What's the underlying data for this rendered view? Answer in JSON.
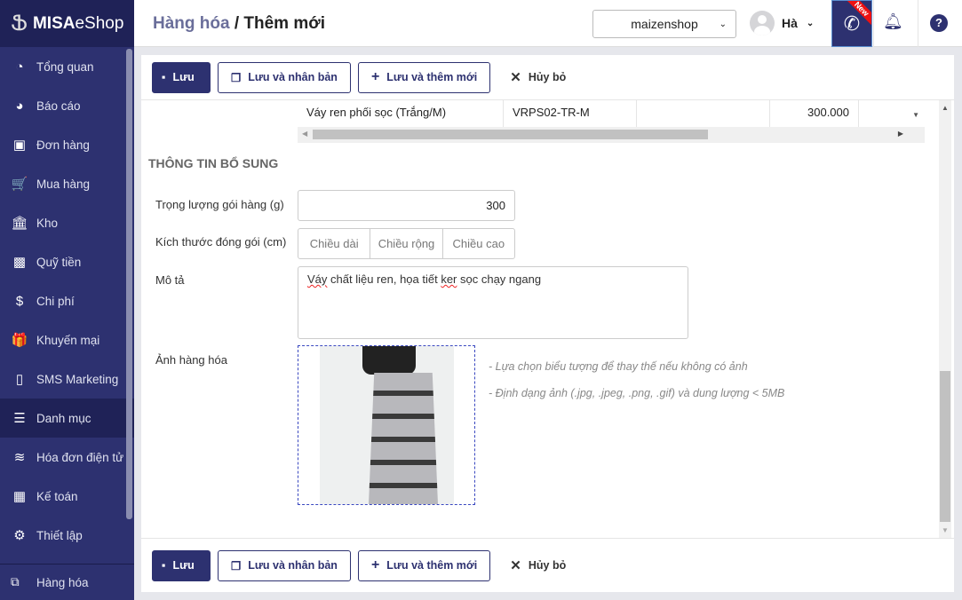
{
  "brand": {
    "logo_bold": "MISA",
    "logo_light": "eShop"
  },
  "sidebar": {
    "items": [
      {
        "label": "Tổng quan",
        "icon": "dashboard-icon",
        "glyph": "◔"
      },
      {
        "label": "Báo cáo",
        "icon": "pie-chart-icon",
        "glyph": "◕"
      },
      {
        "label": "Đơn hàng",
        "icon": "truck-icon",
        "glyph": "▣"
      },
      {
        "label": "Mua hàng",
        "icon": "cart-icon",
        "glyph": "🛒"
      },
      {
        "label": "Kho",
        "icon": "warehouse-icon",
        "glyph": "🏛"
      },
      {
        "label": "Quỹ tiền",
        "icon": "safe-icon",
        "glyph": "▩"
      },
      {
        "label": "Chi phí",
        "icon": "money-icon",
        "glyph": "$"
      },
      {
        "label": "Khuyến mại",
        "icon": "gift-icon",
        "glyph": "🎁"
      },
      {
        "label": "SMS Marketing",
        "icon": "phone-icon",
        "glyph": "▯"
      },
      {
        "label": "Danh mục",
        "icon": "list-icon",
        "glyph": "☰"
      },
      {
        "label": "Hóa đơn điện tử",
        "icon": "invoice-icon",
        "glyph": "≋"
      },
      {
        "label": "Kế toán",
        "icon": "calculator-icon",
        "glyph": "▦"
      },
      {
        "label": "Thiết lập",
        "icon": "gear-icon",
        "glyph": "⚙"
      }
    ],
    "active": "Danh mục",
    "bottom": {
      "label": "Hàng hóa",
      "icon": "boxes-icon",
      "glyph": "⧉"
    }
  },
  "header": {
    "crumb": "Hàng hóa",
    "separator": " / ",
    "title": "Thêm mới",
    "shop": "maizenshop",
    "user": "Hà",
    "new_badge": "New",
    "help": "?"
  },
  "toolbar": {
    "save": "Lưu",
    "save_copy": "Lưu và nhân bản",
    "save_new": "Lưu và thêm mới",
    "cancel": "Hủy bỏ"
  },
  "grid": {
    "row": [
      "Váy ren phối sọc (Trắng/M)",
      "VRPS02-TR-M",
      "",
      "300.000",
      ""
    ]
  },
  "form": {
    "section": "THÔNG TIN BỔ SUNG",
    "weight_label": "Trọng lượng gói hàng (g)",
    "weight_value": "300",
    "size_label": "Kích thước đóng gói (cm)",
    "length_ph": "Chiều dài",
    "width_ph": "Chiều rộng",
    "height_ph": "Chiều cao",
    "desc_label": "Mô tả",
    "desc_w1": "Váy",
    "desc_mid": " chất liệu ren, họa tiết ",
    "desc_w2": "ker",
    "desc_end": " sọc chạy ngang",
    "image_label": "Ảnh hàng hóa",
    "hint1": "- Lựa chọn biểu tượng để thay thế nếu không có ảnh",
    "hint2": "- Định dạng ảnh (.jpg, .jpeg, .png, .gif) và dung lượng < 5MB"
  }
}
